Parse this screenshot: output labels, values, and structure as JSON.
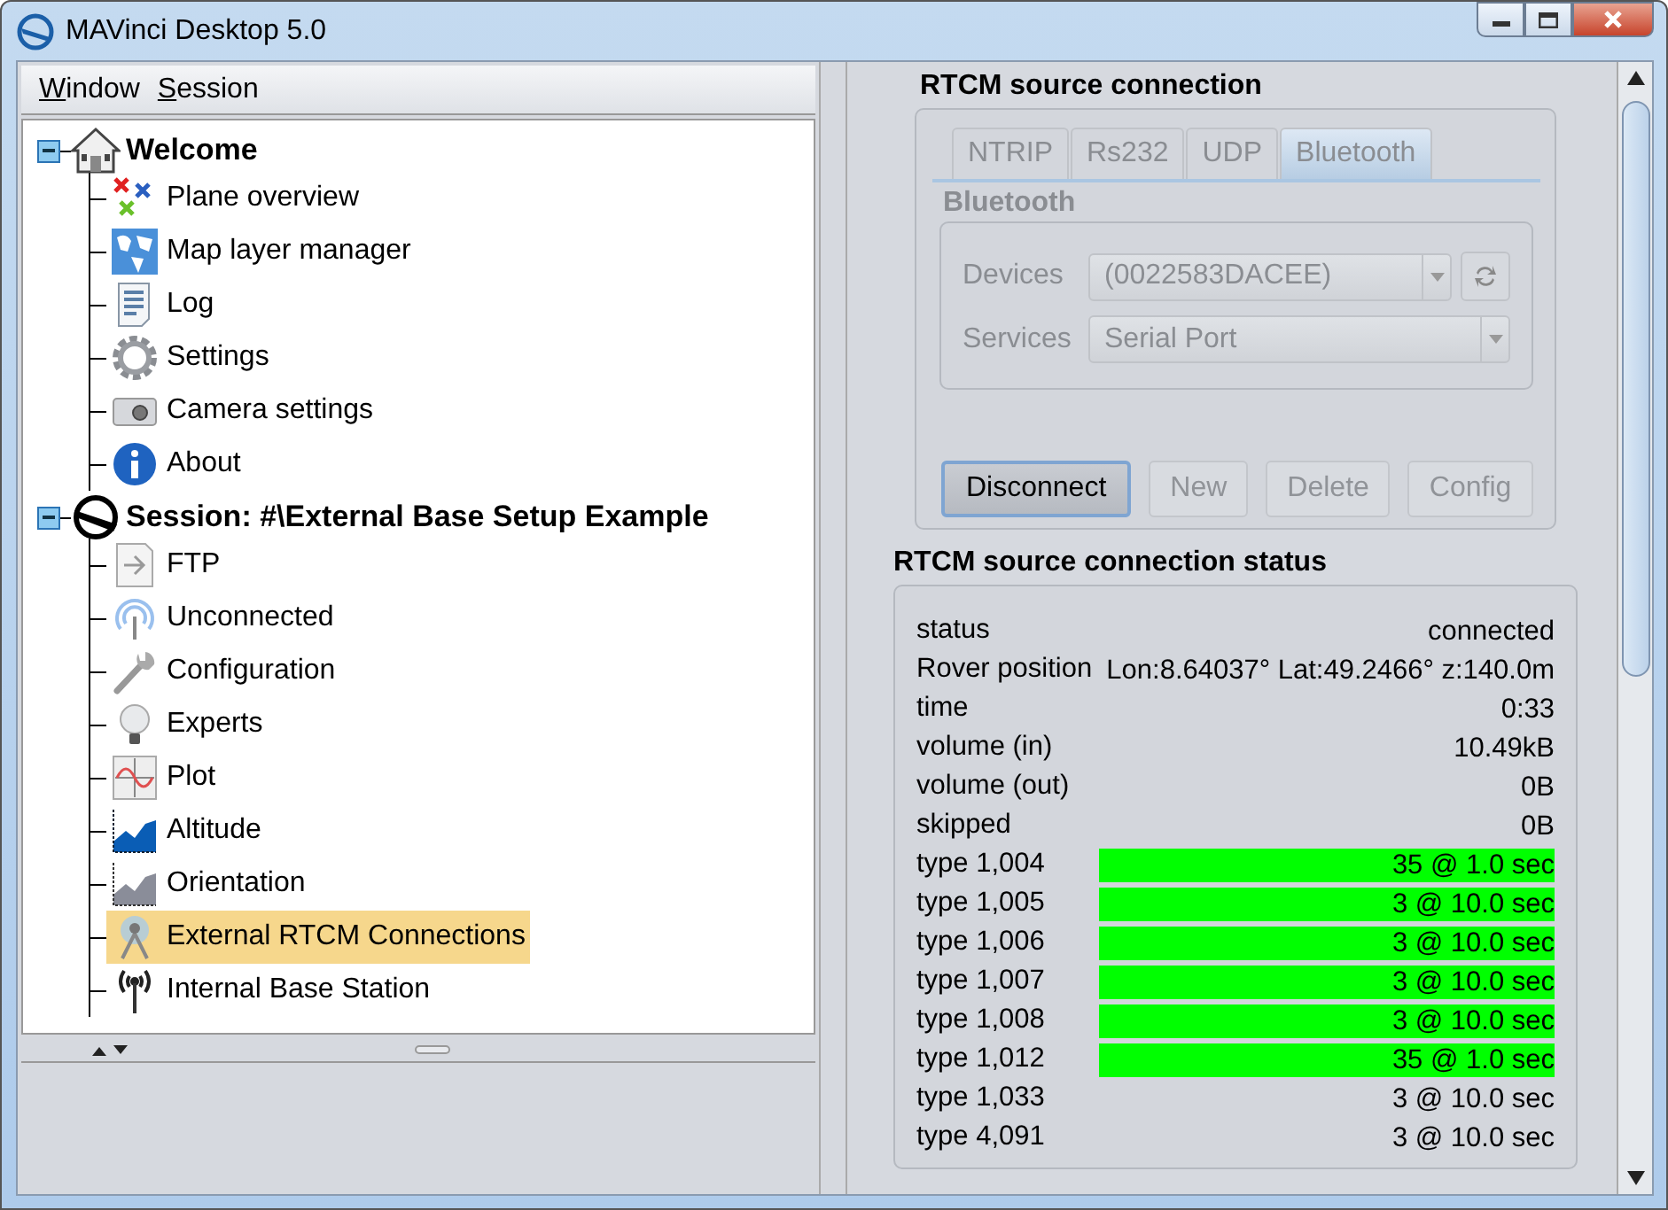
{
  "window": {
    "title": "MAVinci Desktop 5.0"
  },
  "menu": [
    "Window",
    "Session"
  ],
  "tree": [
    {
      "label": "Welcome",
      "expanded": true,
      "children": [
        {
          "label": "Plane overview",
          "selected": false
        },
        {
          "label": "Map layer manager",
          "selected": false
        },
        {
          "label": "Log",
          "selected": false
        },
        {
          "label": "Settings",
          "selected": false
        },
        {
          "label": "Camera settings",
          "selected": false
        },
        {
          "label": "About",
          "selected": false
        }
      ]
    },
    {
      "label": "Session: #\\External Base Setup Example",
      "expanded": true,
      "children": [
        {
          "label": "FTP",
          "selected": false
        },
        {
          "label": "Unconnected",
          "selected": false
        },
        {
          "label": "Configuration",
          "selected": false
        },
        {
          "label": "Experts",
          "selected": false
        },
        {
          "label": "Plot",
          "selected": false
        },
        {
          "label": "Altitude",
          "selected": false
        },
        {
          "label": "Orientation",
          "selected": false
        },
        {
          "label": "External RTCM Connections",
          "selected": true
        },
        {
          "label": "Internal Base Station",
          "selected": false
        }
      ]
    }
  ],
  "connection": {
    "title": "RTCM source connection",
    "tabs": [
      {
        "label": "NTRIP",
        "selected": false
      },
      {
        "label": "Rs232",
        "selected": false
      },
      {
        "label": "UDP",
        "selected": false
      },
      {
        "label": "Bluetooth",
        "selected": true
      }
    ],
    "panel_title": "Bluetooth",
    "disabled": true,
    "fields": [
      {
        "label": "Devices",
        "value": "(0022583DACEE)",
        "refresh": true
      },
      {
        "label": "Services",
        "value": "Serial Port",
        "refresh": false
      }
    ],
    "buttons": [
      {
        "label": "Disconnect",
        "disabled": false
      },
      {
        "label": "New",
        "disabled": true
      },
      {
        "label": "Delete",
        "disabled": true
      },
      {
        "label": "Config",
        "disabled": true
      }
    ]
  },
  "status": {
    "title": "RTCM source connection status",
    "rows": [
      {
        "label": "status",
        "value": "connected",
        "highlighted": false
      },
      {
        "label": "Rover position",
        "value": "Lon:8.64037° Lat:49.2466° z:140.0m",
        "highlighted": false
      },
      {
        "label": "time",
        "value": "0:33",
        "highlighted": false
      },
      {
        "label": "volume (in)",
        "value": "10.49kB",
        "highlighted": false
      },
      {
        "label": "volume (out)",
        "value": "0B",
        "highlighted": false
      },
      {
        "label": "skipped",
        "value": "0B",
        "highlighted": false
      },
      {
        "label": "type 1,004",
        "value": "35 @ 1.0 sec",
        "highlighted": true
      },
      {
        "label": "type 1,005",
        "value": "3 @ 10.0 sec",
        "highlighted": true
      },
      {
        "label": "type 1,006",
        "value": "3 @ 10.0 sec",
        "highlighted": true
      },
      {
        "label": "type 1,007",
        "value": "3 @ 10.0 sec",
        "highlighted": true
      },
      {
        "label": "type 1,008",
        "value": "3 @ 10.0 sec",
        "highlighted": true
      },
      {
        "label": "type 1,012",
        "value": "35 @ 1.0 sec",
        "highlighted": true
      },
      {
        "label": "type 1,033",
        "value": "3 @ 10.0 sec",
        "highlighted": false
      },
      {
        "label": "type 4,091",
        "value": "3 @ 10.0 sec",
        "highlighted": false
      }
    ]
  }
}
